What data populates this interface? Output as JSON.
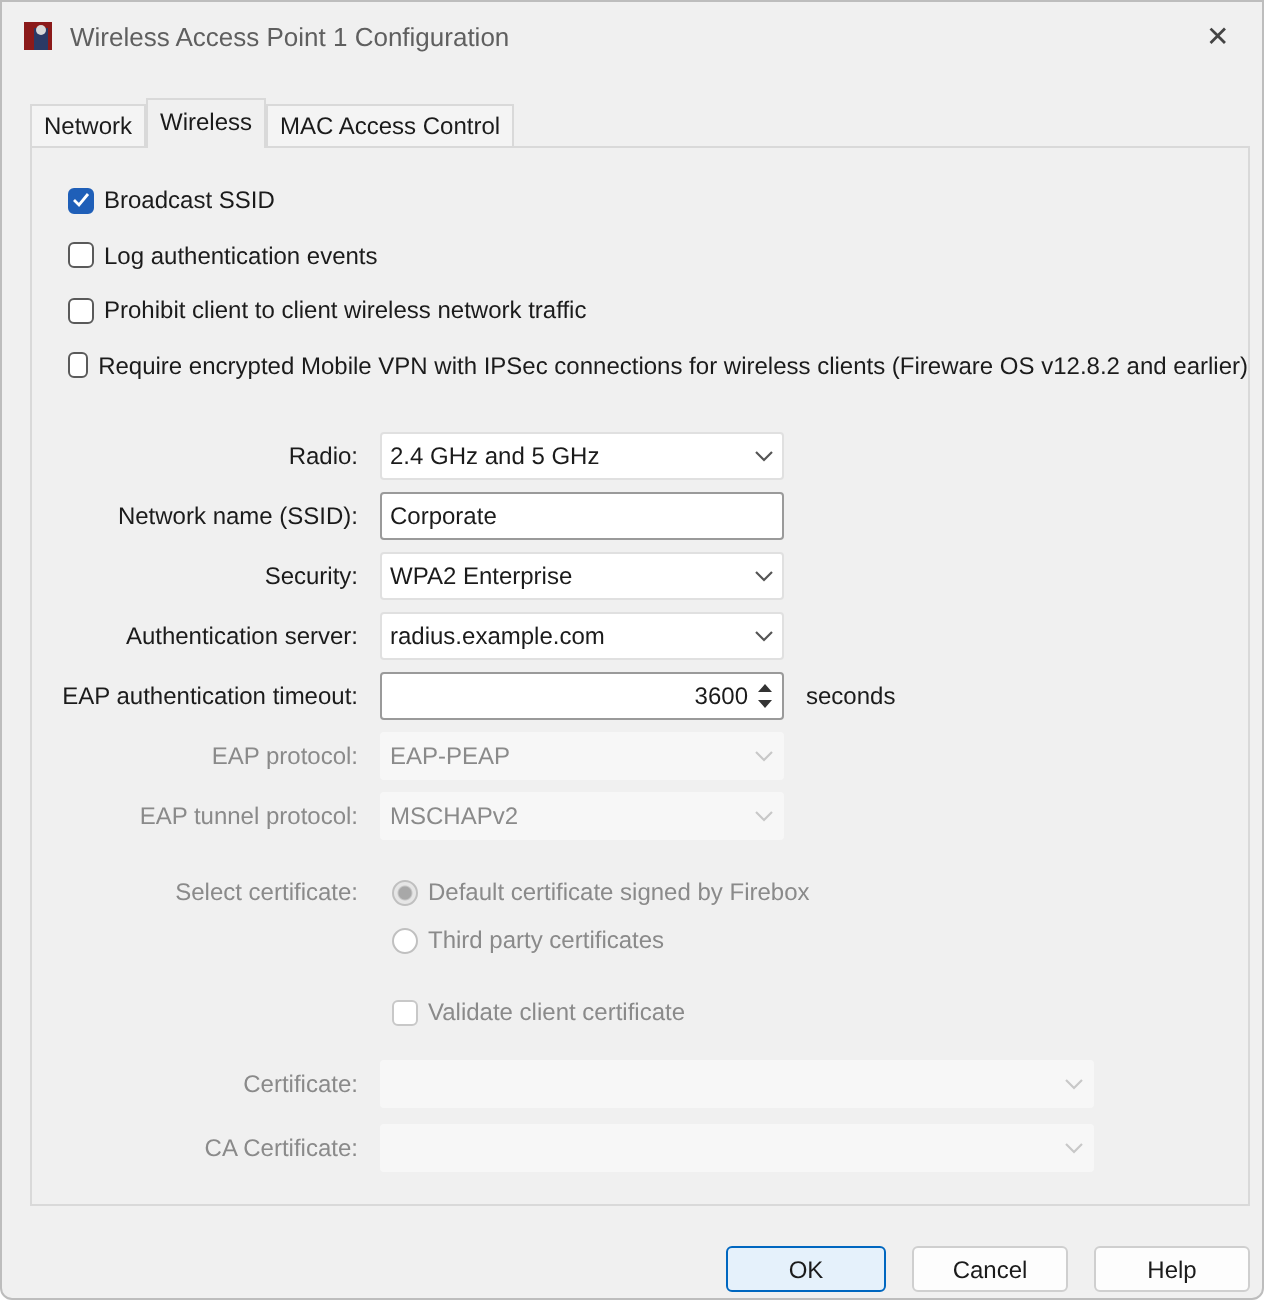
{
  "window": {
    "title": "Wireless Access Point 1 Configuration",
    "close": "✕"
  },
  "tabs": [
    {
      "label": "Network",
      "selected": false
    },
    {
      "label": "Wireless",
      "selected": true
    },
    {
      "label": "MAC Access Control",
      "selected": false
    }
  ],
  "options": [
    {
      "label": "Broadcast SSID",
      "checked": true
    },
    {
      "label": "Log authentication events",
      "checked": false
    },
    {
      "label": "Prohibit client to client wireless network traffic",
      "checked": false
    },
    {
      "label": "Require encrypted Mobile VPN with IPSec connections for wireless clients (Fireware OS v12.8.2 and earlier)",
      "checked": false
    }
  ],
  "fields": [
    {
      "kind": "select",
      "label": "Radio:",
      "value": "2.4 GHz and 5 GHz",
      "disabled": false
    },
    {
      "kind": "text",
      "label": "Network name (SSID):",
      "value": "Corporate",
      "disabled": false
    },
    {
      "kind": "select",
      "label": "Security:",
      "value": "WPA2 Enterprise",
      "disabled": false
    },
    {
      "kind": "select",
      "label": "Authentication server:",
      "value": "radius.example.com",
      "disabled": false
    },
    {
      "kind": "spinner",
      "label": "EAP authentication timeout:",
      "value": "3600",
      "unit": "seconds",
      "disabled": false
    },
    {
      "kind": "select",
      "label": "EAP protocol:",
      "value": "EAP-PEAP",
      "disabled": true
    },
    {
      "kind": "select",
      "label": "EAP tunnel protocol:",
      "value": "MSCHAPv2",
      "disabled": true
    }
  ],
  "certificate": {
    "label": "Select certificate:",
    "disabled": true,
    "choices": [
      {
        "label": "Default certificate signed by Firebox",
        "selected": true
      },
      {
        "label": "Third party certificates",
        "selected": false
      }
    ],
    "validate": {
      "label": "Validate client certificate",
      "checked": false
    },
    "fields": [
      {
        "label": "Certificate:"
      },
      {
        "label": "CA Certificate:"
      }
    ]
  },
  "buttons": [
    {
      "label": "OK",
      "default": true
    },
    {
      "label": "Cancel",
      "default": false
    },
    {
      "label": "Help",
      "default": false
    }
  ]
}
